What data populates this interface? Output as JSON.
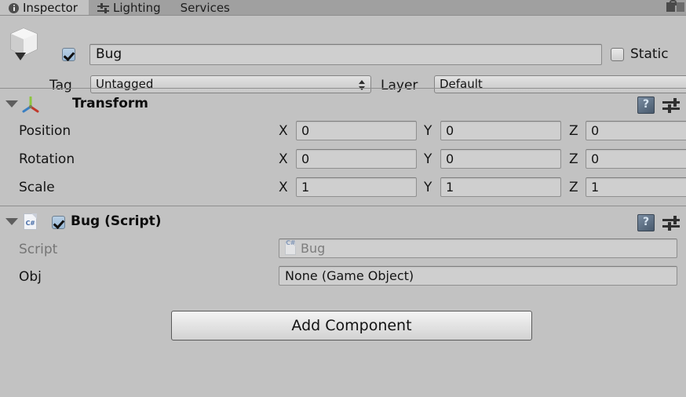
{
  "window": {
    "tabs": [
      {
        "label": "Inspector",
        "icon": "inspector-icon",
        "active": true
      },
      {
        "label": "Lighting",
        "icon": "lighting-icon",
        "active": false
      },
      {
        "label": "Services",
        "icon": "",
        "active": false
      }
    ],
    "lock_icon": "lock-icon",
    "menu_icon": "hamburger-menu-icon"
  },
  "object_header": {
    "prefab_icon": "cube-icon",
    "enabled_checkbox": true,
    "name": "Bug",
    "name_placeholder": "Name",
    "static_label": "Static",
    "static_checked": false,
    "tag_label": "Tag",
    "tag_value": "Untagged",
    "layer_label": "Layer",
    "layer_value": "Default"
  },
  "components": [
    {
      "id": "transform",
      "title": "Transform",
      "icon": "transform-gizmo-icon",
      "expanded": true,
      "has_enable_checkbox": false,
      "help_icon": "help-book-icon",
      "settings_icon": "settings-sliders-icon",
      "rows": [
        {
          "label": "Position",
          "x": "0",
          "y": "0",
          "z": "0"
        },
        {
          "label": "Rotation",
          "x": "0",
          "y": "0",
          "z": "0"
        },
        {
          "label": "Scale",
          "x": "1",
          "y": "1",
          "z": "1"
        }
      ],
      "axis_labels": {
        "x": "X",
        "y": "Y",
        "z": "Z"
      }
    },
    {
      "id": "bug-script",
      "title": "Bug (Script)",
      "icon": "csharp-script-icon",
      "icon_text": "C#",
      "expanded": true,
      "has_enable_checkbox": true,
      "enabled": true,
      "help_icon": "help-book-icon",
      "settings_icon": "settings-sliders-icon",
      "fields": [
        {
          "label": "Script",
          "value": "Bug",
          "disabled": true,
          "icon": "csharp-script-icon",
          "icon_text": "C#"
        },
        {
          "label": "Obj",
          "value": "None (Game Object)",
          "disabled": false,
          "icon": "",
          "icon_text": ""
        }
      ]
    }
  ],
  "footer": {
    "add_component_label": "Add Component"
  },
  "colors": {
    "panel_bg": "#c2c2c2",
    "tabbar_bg": "#a0a0a0",
    "field_bg": "#cfcfcf",
    "text": "#141414",
    "text_disabled": "#757575",
    "checkbox_on": "#9ab9d6",
    "axis_x": "#c0392b",
    "axis_y": "#8dc63f",
    "axis_z": "#3a7fc1"
  }
}
